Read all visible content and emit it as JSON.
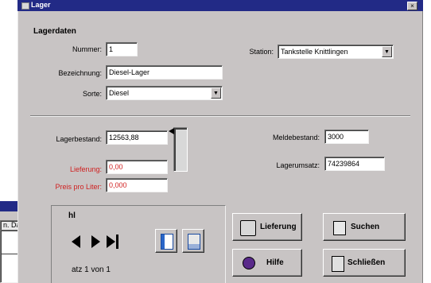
{
  "window": {
    "title": "Lager",
    "close_glyph": "×"
  },
  "group": {
    "title": "Lagerdaten"
  },
  "fields": {
    "nummer": {
      "label": "Nummer:",
      "value": "1"
    },
    "bezeichnung": {
      "label": "Bezeichnung:",
      "value": "Diesel-Lager"
    },
    "sorte": {
      "label": "Sorte:",
      "value": "Diesel"
    },
    "station": {
      "label": "Station:",
      "value": "Tankstelle Knittlingen"
    },
    "lagerbestand": {
      "label": "Lagerbestand:",
      "value": "12563,88"
    },
    "lieferung": {
      "label": "Lieferung:",
      "value": "0,00"
    },
    "preis": {
      "label": "Preis pro Liter:",
      "value": "0,000"
    },
    "meldebestand": {
      "label": "Meldebestand:",
      "value": "3000"
    },
    "lagerumsatz": {
      "label": "Lagerumsatz:",
      "value": "74239864"
    }
  },
  "navigation": {
    "section_label": "hl",
    "record_text": "atz 1 von 1",
    "next": "▶",
    "last": "▶|"
  },
  "buttons": {
    "lieferung": "Lieferung",
    "suchen": "Suchen",
    "hilfe": "Hilfe",
    "schliessen": "Schließen"
  },
  "window2": {
    "header_text": "n. Datei",
    "close_glyph": "×"
  },
  "colors": {
    "titlebar": "#222a86",
    "window_bg": "#c8c4c4",
    "red_label": "#d02020"
  }
}
